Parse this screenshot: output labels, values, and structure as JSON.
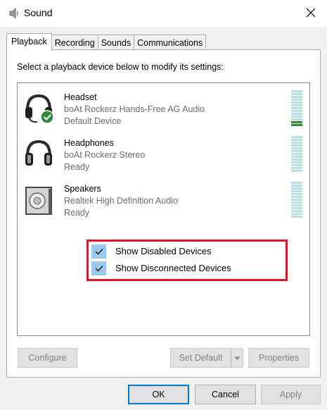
{
  "window": {
    "title": "Sound",
    "icon": "speaker-icon",
    "close_icon": "close-icon"
  },
  "tabs": [
    {
      "label": "Playback",
      "active": true
    },
    {
      "label": "Recording",
      "active": false
    },
    {
      "label": "Sounds",
      "active": false
    },
    {
      "label": "Communications",
      "active": false
    }
  ],
  "instruction": "Select a playback device below to modify its settings:",
  "devices": [
    {
      "name": "Headset",
      "description": "boAt Rockerz Hands-Free AG Audio",
      "status": "Default Device",
      "icon": "headset-icon",
      "default": true,
      "level_bars": 2
    },
    {
      "name": "Headphones",
      "description": "boAt Rockerz Stereo",
      "status": "Ready",
      "icon": "headphones-icon",
      "default": false,
      "level_bars": 0
    },
    {
      "name": "Speakers",
      "description": "Realtek High Definition Audio",
      "status": "Ready",
      "icon": "speakers-icon",
      "default": false,
      "level_bars": 0
    }
  ],
  "context_menu": {
    "items": [
      {
        "label": "Show Disabled Devices",
        "checked": true
      },
      {
        "label": "Show Disconnected Devices",
        "checked": true
      }
    ],
    "highlight_color": "#e81224"
  },
  "panel_buttons": {
    "configure": "Configure",
    "set_default": "Set Default",
    "properties": "Properties"
  },
  "dialog_buttons": {
    "ok": "OK",
    "cancel": "Cancel",
    "apply": "Apply"
  },
  "colors": {
    "accent": "#0078d7",
    "meter_idle": "#b8e0e8",
    "meter_active": "#2f8a2f",
    "check_bg": "#99c9ef",
    "default_badge": "#2e8b3a"
  }
}
